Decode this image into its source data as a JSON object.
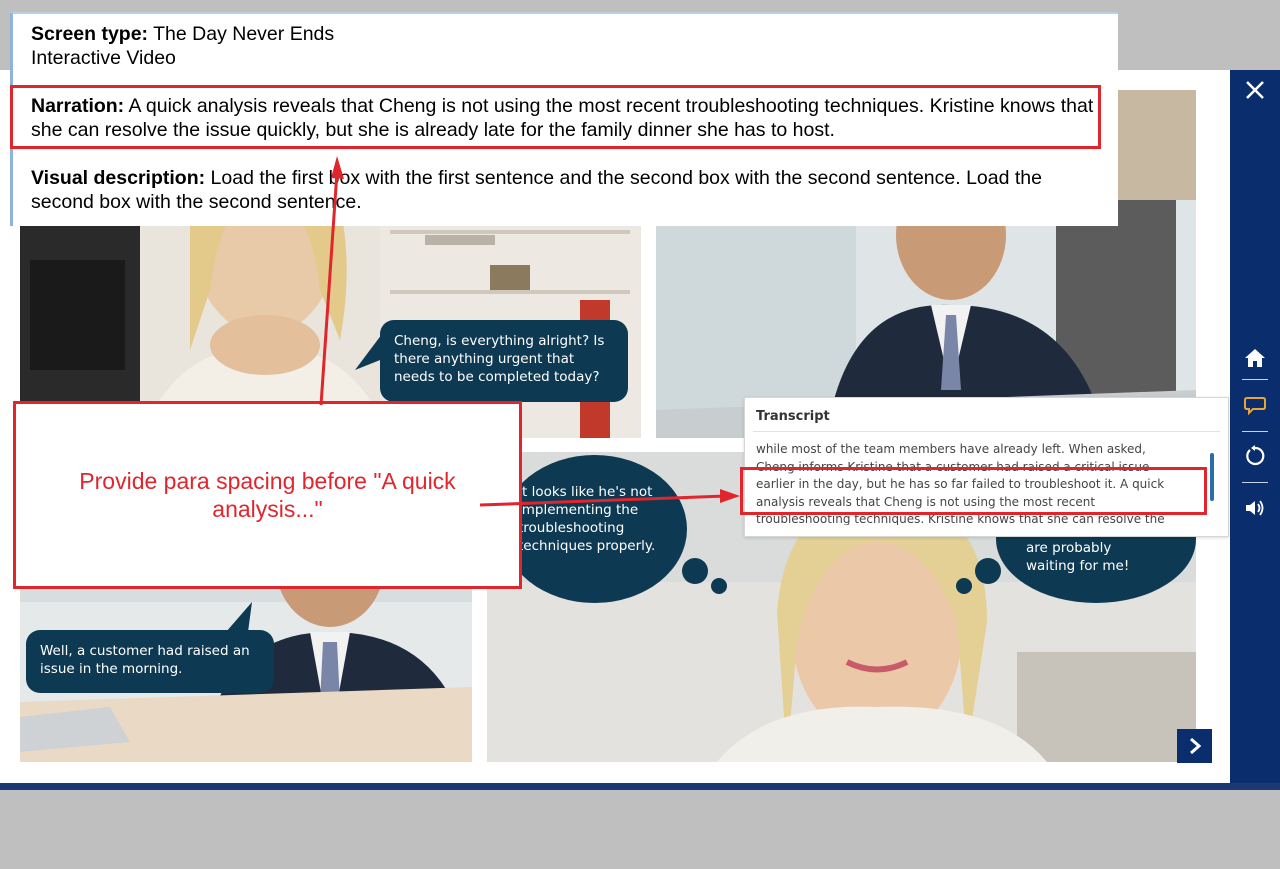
{
  "annotation": {
    "screen_type_label": "Screen type:",
    "screen_type_value": "The Day Never Ends",
    "screen_type_sub": "Interactive Video",
    "narration_label": "Narration:",
    "narration_text": "A quick analysis reveals that Cheng is not using the most recent troubleshooting techniques. Kristine knows that she can resolve the issue quickly, but she is already late for the family dinner she has to host.",
    "visual_label": "Visual description:",
    "visual_text": "Load the first box with the first sentence and the second box with the second sentence. Load the second box with the second sentence."
  },
  "callout": {
    "text": "Provide para spacing before \"A quick analysis...\""
  },
  "bubbles": {
    "kristine_question": "Cheng, is everything alright? Is there anything urgent that needs to be completed today?",
    "cheng_reply": "Well, a customer had raised an issue in the morning.",
    "thought_left": "It looks like he's not implementing the troubleshooting techniques properly.",
    "thought_right": "are probably waiting for me!"
  },
  "transcript": {
    "title": "Transcript",
    "lines": [
      "while most of the team members have already left. When asked,",
      "Cheng informs Kristine that a customer had raised a critical issue",
      "earlier in the day, but he has so far failed to troubleshoot it. A quick",
      "analysis reveals that Cheng is not using the most recent",
      "troubleshooting techniques. Kristine knows that she can resolve the"
    ]
  },
  "sidebar": {
    "close_icon": "close-icon",
    "home_icon": "home-icon",
    "transcript_icon": "speech-bubble-icon",
    "replay_icon": "replay-icon",
    "audio_icon": "speaker-icon"
  },
  "colors": {
    "sidebar": "#0a2d6e",
    "bubble": "#0d3a52",
    "annotation_red": "#e0252d",
    "transcript_icon_active": "#e8a33d"
  }
}
